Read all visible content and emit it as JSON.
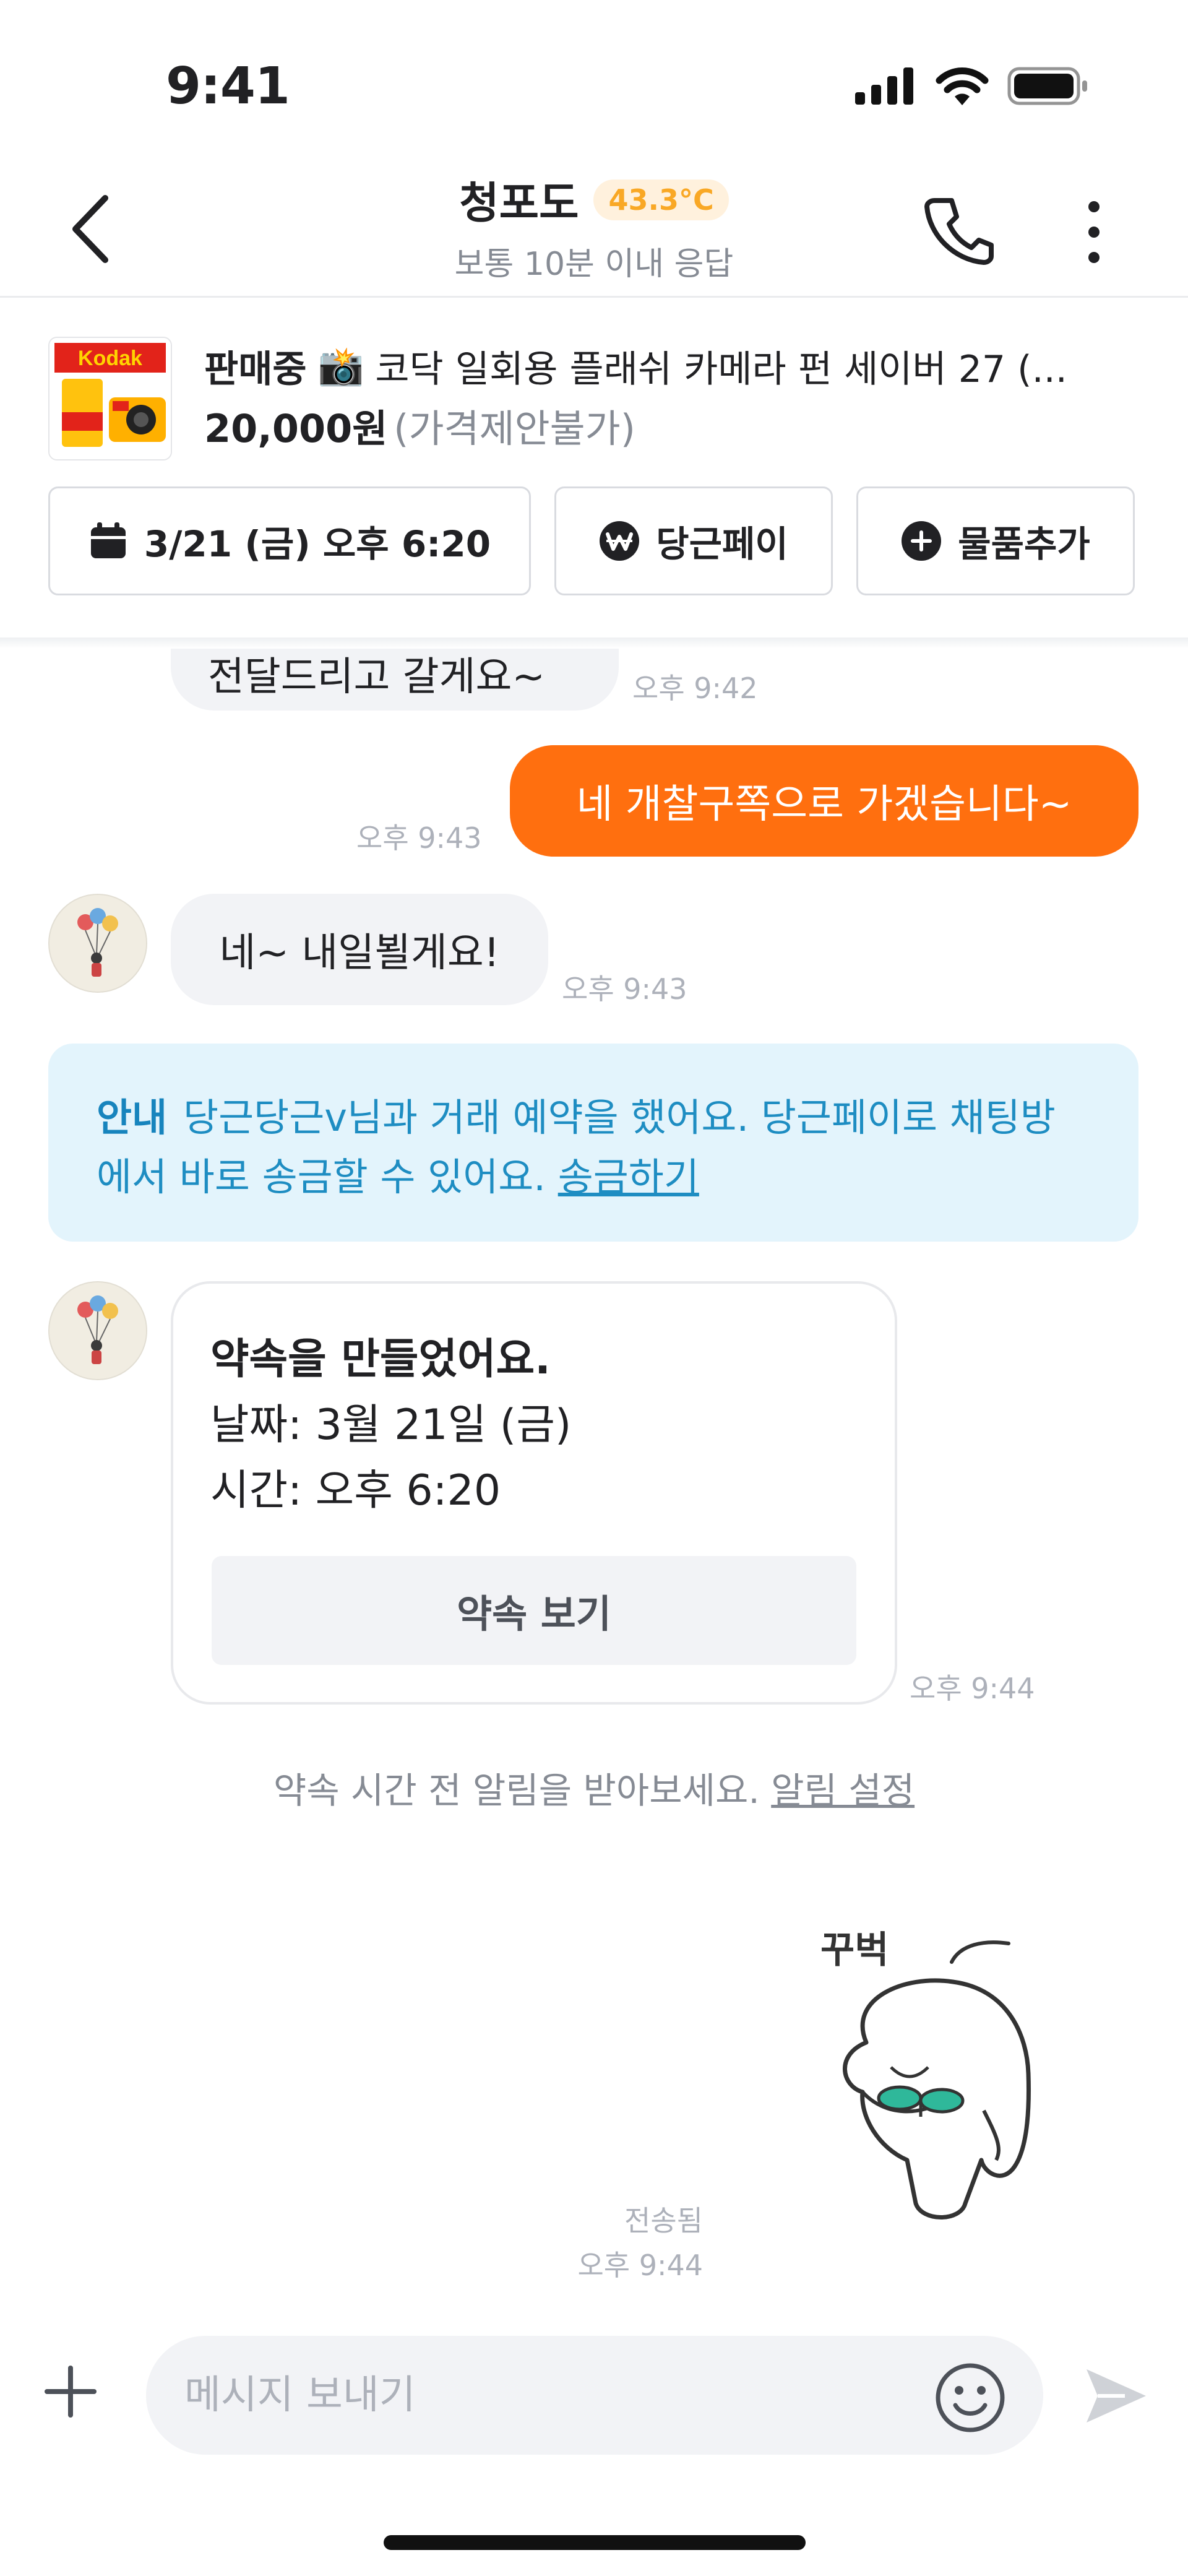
{
  "status_bar": {
    "time": "9:41"
  },
  "header": {
    "name": "청포도",
    "temperature": "43.3°C",
    "response": "보통 10분 이내 응답"
  },
  "product": {
    "brand_logo": "Kodak",
    "status": "판매중",
    "title_emoji": "📸",
    "title": "코닥 일회용 플래쉬 카메라 펀 세이버 27 (...",
    "price": "20,000원",
    "negotiation": "(가격제안불가)"
  },
  "actions": {
    "schedule": "3/21 (금) 오후 6:20",
    "pay": "당근페이",
    "add_item": "물품추가"
  },
  "messages": {
    "partial_text": "전달드리고 갈게요~",
    "partial_time": "오후 9:42",
    "out1_text": "네 개찰구쪽으로 가겠습니다~",
    "out1_time": "오후 9:43",
    "in1_text": "네~ 내일뵐게요!",
    "in1_time": "오후 9:43"
  },
  "notice": {
    "label": "안내",
    "text": "당근당근v님과 거래 예약을 했어요. 당근페이로 채팅방에서 바로 송금할 수 있어요.",
    "link": "송금하기"
  },
  "appointment_card": {
    "title": "약속을 만들었어요.",
    "date": "날짜: 3월 21일 (금)",
    "time": "시간: 오후 6:20",
    "button": "약속 보기",
    "timestamp": "오후 9:44"
  },
  "reminder": {
    "text": "약속 시간 전 알림을 받아보세요.",
    "link": "알림 설정"
  },
  "sticker": {
    "caption": "꾸벅",
    "status": "전송됨",
    "time": "오후 9:44"
  },
  "input_bar": {
    "placeholder": "메시지 보내기",
    "value": ""
  },
  "colors": {
    "accent": "#ff6f0f",
    "notice_bg": "#e3f4fc",
    "notice_text": "#1e8dc2",
    "temperature": "#f9a825"
  }
}
